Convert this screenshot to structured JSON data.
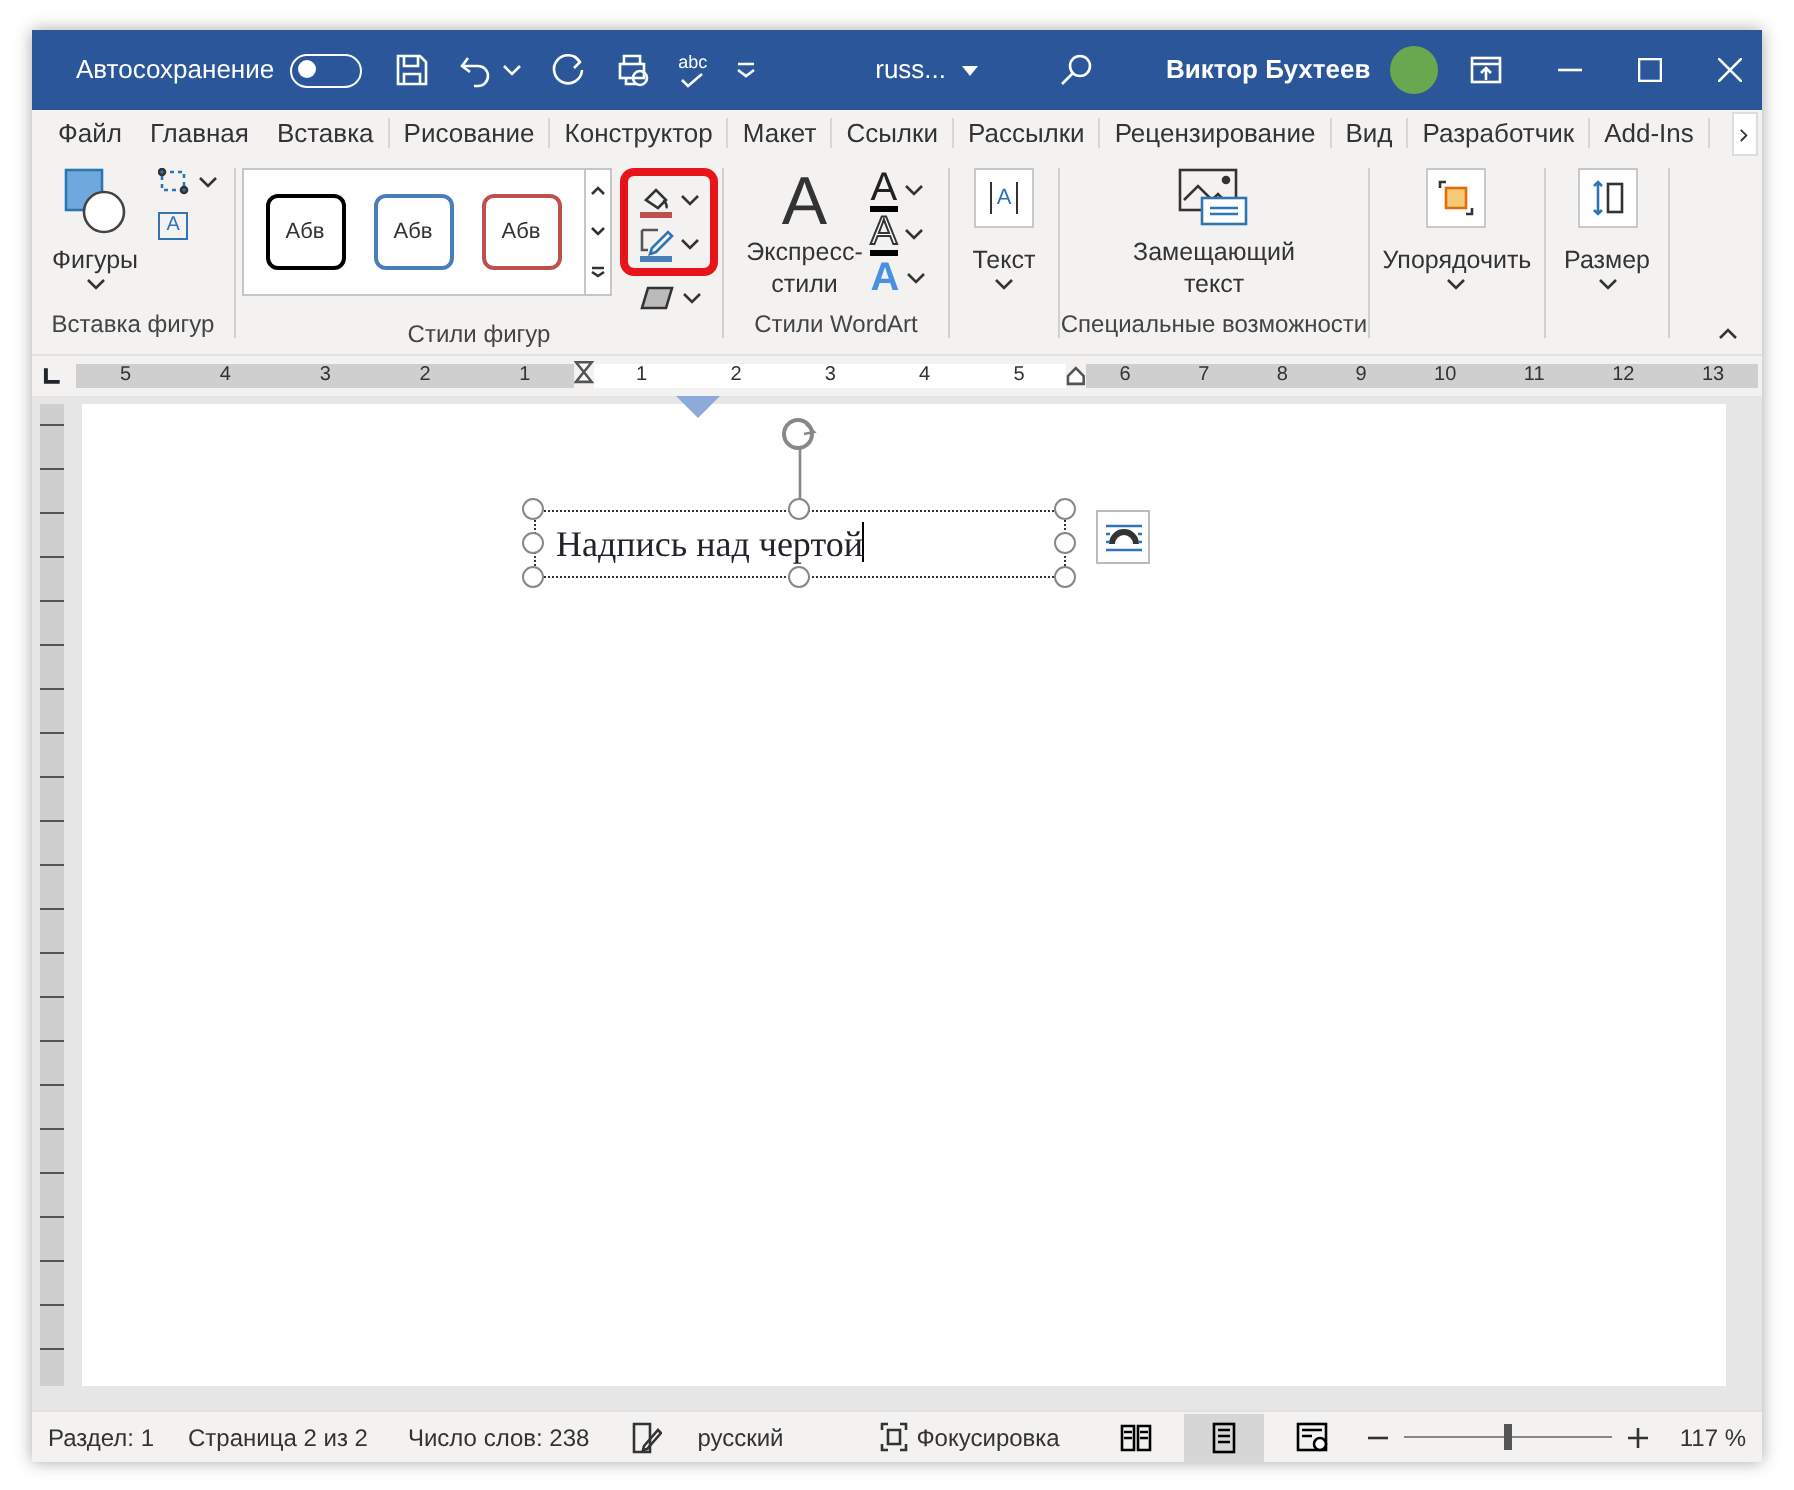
{
  "title_bar": {
    "autosave_label": "Автосохранение",
    "autosave_on": false,
    "spell_check_label": "abc",
    "document_name": "russ...",
    "user_name": "Виктор Бухтеев"
  },
  "tabs": [
    {
      "label": "Файл",
      "selected": false
    },
    {
      "label": "Главная",
      "selected": false
    },
    {
      "label": "Вставка",
      "selected": false
    },
    {
      "label": "Рисование",
      "selected": false
    },
    {
      "label": "Конструктор",
      "selected": false
    },
    {
      "label": "Макет",
      "selected": false
    },
    {
      "label": "Ссылки",
      "selected": false
    },
    {
      "label": "Рассылки",
      "selected": false
    },
    {
      "label": "Рецензирование",
      "selected": false
    },
    {
      "label": "Вид",
      "selected": false
    },
    {
      "label": "Разработчик",
      "selected": false
    },
    {
      "label": "Add-Ins",
      "selected": false
    }
  ],
  "ribbon": {
    "groups": [
      {
        "kind": "shapes",
        "label": "Вставка фигур",
        "button": "Фигуры",
        "textbox_icon_letter": "A"
      },
      {
        "kind": "shape_styles",
        "label": "Стили фигур",
        "highlighted": true,
        "samples": [
          {
            "text": "Абв",
            "color": "#000000"
          },
          {
            "text": "Абв",
            "color": "#4a7ebb"
          },
          {
            "text": "Абв",
            "color": "#c0504d"
          }
        ]
      },
      {
        "kind": "wordart",
        "label": "Стили WordArt",
        "button": "Экспресс-стили",
        "express_letter": "A",
        "effect_letters": [
          "A",
          "A",
          "A"
        ]
      },
      {
        "kind": "text",
        "button": "Текст",
        "icon_letter": "A"
      },
      {
        "kind": "accessibility",
        "label": "Специальные возможности",
        "button": "Замещающий текст"
      },
      {
        "kind": "arrange",
        "button": "Упорядочить"
      },
      {
        "kind": "size",
        "button": "Размер"
      }
    ]
  },
  "ruler": {
    "left_labels": [
      "5",
      "4",
      "3",
      "2",
      "1"
    ],
    "text_labels": [
      "1",
      "2",
      "3",
      "4",
      "5"
    ],
    "right_labels": [
      "6",
      "7",
      "8",
      "9",
      "10",
      "11",
      "12",
      "13"
    ]
  },
  "document": {
    "text_box": "Надпись над чертой"
  },
  "status_bar": {
    "section": "Раздел: 1",
    "page": "Страница 2 из 2",
    "words": "Число слов: 238",
    "language": "русский",
    "focus": "Фокусировка",
    "views": [
      {
        "kind": "read",
        "selected": false
      },
      {
        "kind": "print",
        "selected": true
      },
      {
        "kind": "web",
        "selected": false
      }
    ],
    "zoom": {
      "level": 0.5,
      "reading": "117 %"
    }
  }
}
